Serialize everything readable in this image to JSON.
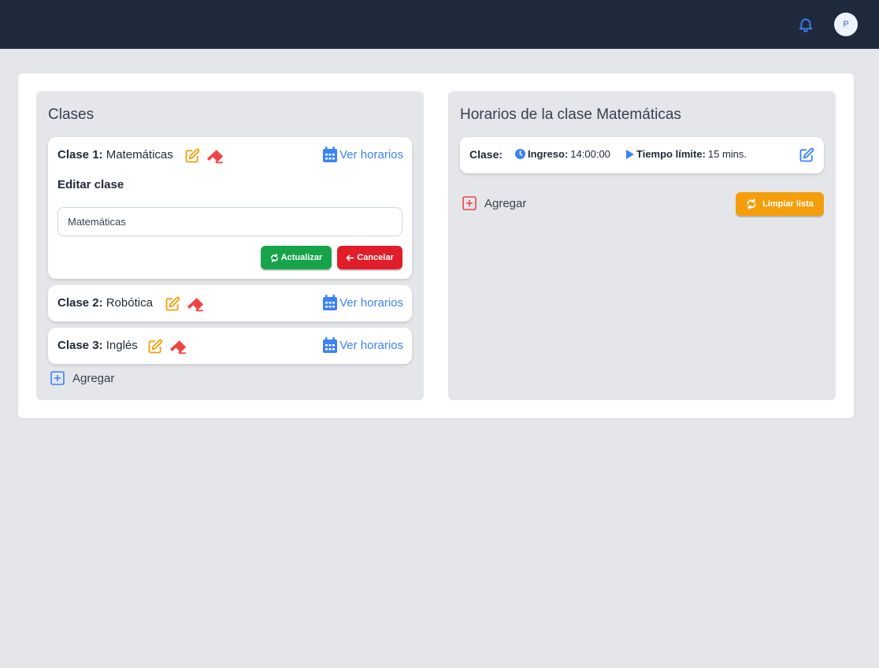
{
  "header": {
    "bell_icon": "bell-icon",
    "avatar_initial": "P"
  },
  "clases_panel": {
    "title": "Clases",
    "items": [
      {
        "label": "Clase 1:",
        "name": "Matemáticas",
        "ver_horarios": "Ver horarios"
      },
      {
        "label": "Clase 2:",
        "name": "Robótica",
        "ver_horarios": "Ver horarios"
      },
      {
        "label": "Clase 3:",
        "name": "Inglés",
        "ver_horarios": "Ver horarios"
      }
    ],
    "edit_form": {
      "title": "Editar clase",
      "input_value": "Matemáticas",
      "update_label": "Actualizar",
      "cancel_label": "Cancelar"
    },
    "add_label": "Agregar"
  },
  "horarios_panel": {
    "title": "Horarios de la clase Matemáticas",
    "schedule": {
      "label": "Clase:",
      "ingreso_label": "Ingreso:",
      "ingreso_value": "14:00:00",
      "tiempo_label": "Tiempo límite:",
      "tiempo_value": "15 mins."
    },
    "add_label": "Agregar",
    "clear_label": "Limpiar lista"
  },
  "colors": {
    "topbar": "#1e293b",
    "accent_blue": "#3b82f6",
    "edit_orange": "#f59e0b",
    "delete_red": "#ef4444",
    "update_green": "#16a34a",
    "cancel_red": "#e11d2a"
  }
}
